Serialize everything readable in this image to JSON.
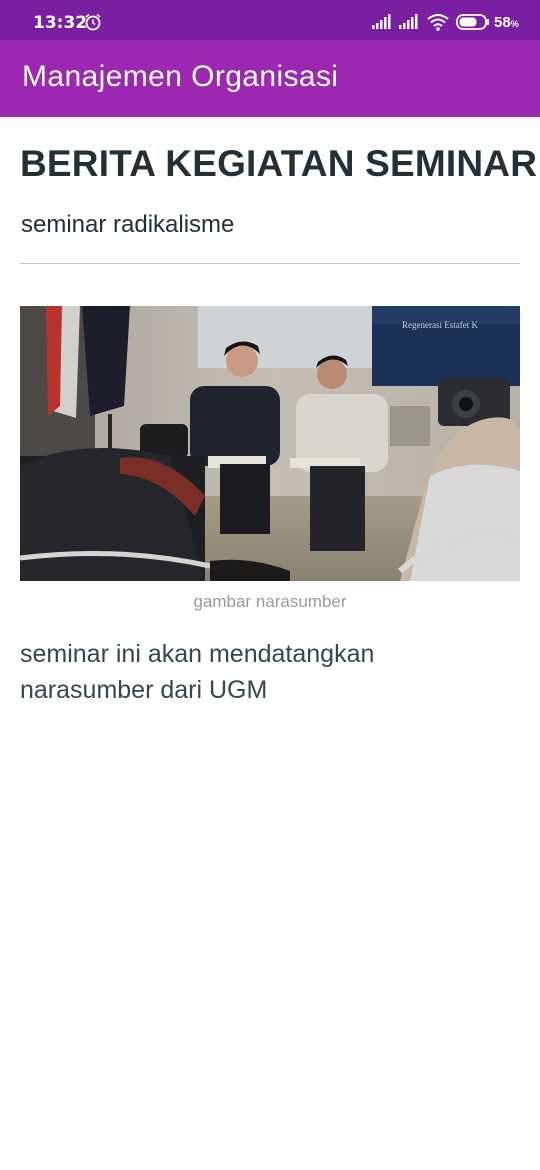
{
  "status_bar": {
    "time": "13:32",
    "battery": "58",
    "battery_unit": "%"
  },
  "app_bar": {
    "title": "Manajemen Organisasi"
  },
  "article": {
    "title": "BERITA KEGIATAN SEMINAR",
    "subtitle": "seminar radikalisme",
    "image_caption": "gambar narasumber",
    "body": "seminar ini akan mendatangkan narasumber dari UGM",
    "projection_text": "Regenerasi Estafet K"
  },
  "colors": {
    "status_bar": "#7b1fa2",
    "app_bar": "#9c27b0",
    "title_text": "#243038"
  },
  "icons": [
    "alarm-icon",
    "signal-icon",
    "wifi-icon",
    "battery-icon"
  ]
}
